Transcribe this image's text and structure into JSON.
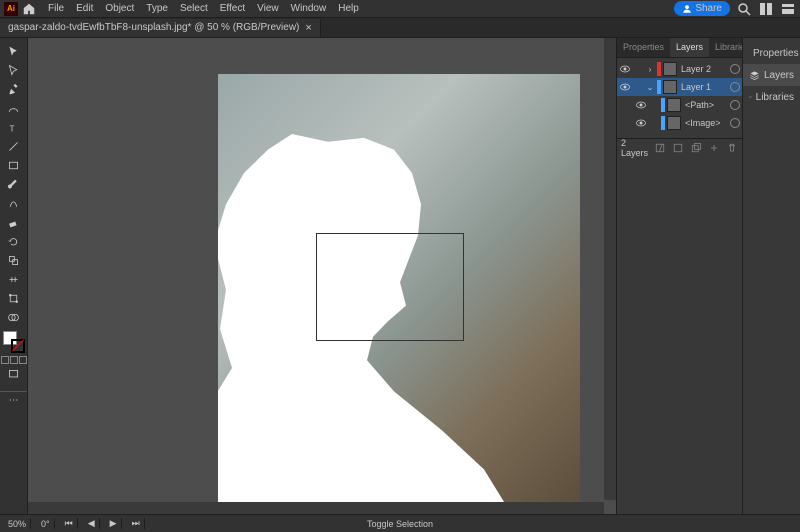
{
  "app": {
    "logo_text": "Ai"
  },
  "menu": {
    "items": [
      "File",
      "Edit",
      "Object",
      "Type",
      "Select",
      "Effect",
      "View",
      "Window",
      "Help"
    ]
  },
  "menubar_right": {
    "share_label": "Share"
  },
  "tab": {
    "title": "gaspar-zaldo-tvdEwfbTbF8-unsplash.jpg* @ 50 % (RGB/Preview)",
    "close": "×"
  },
  "panels": {
    "tabs": [
      "Properties",
      "Layers",
      "Libraries"
    ],
    "active_index": 1
  },
  "layers": {
    "rows": [
      {
        "name": "Layer 2",
        "color": "#d33",
        "indent": 0,
        "expanded": false,
        "selected": false
      },
      {
        "name": "Layer 1",
        "color": "#4aa3ff",
        "indent": 0,
        "expanded": true,
        "selected": true
      },
      {
        "name": "<Path>",
        "color": "#4aa3ff",
        "indent": 1,
        "expanded": false,
        "selected": false
      },
      {
        "name": "<Image>",
        "color": "#4aa3ff",
        "indent": 1,
        "expanded": false,
        "selected": false
      }
    ],
    "count_label": "2 Layers"
  },
  "dock": {
    "items": [
      "Properties",
      "Layers",
      "Libraries"
    ],
    "active_index": 1
  },
  "status": {
    "zoom": "50%",
    "rotate": "0°",
    "hint": "Toggle Selection"
  },
  "tools": {
    "names": [
      "selection",
      "direct-selection",
      "pen",
      "curvature",
      "type",
      "line",
      "rectangle",
      "paintbrush",
      "shaper",
      "eraser",
      "rotate",
      "scale",
      "width",
      "free-transform",
      "shape-builder",
      "perspective",
      "mesh",
      "gradient",
      "eyedropper",
      "blend"
    ]
  }
}
